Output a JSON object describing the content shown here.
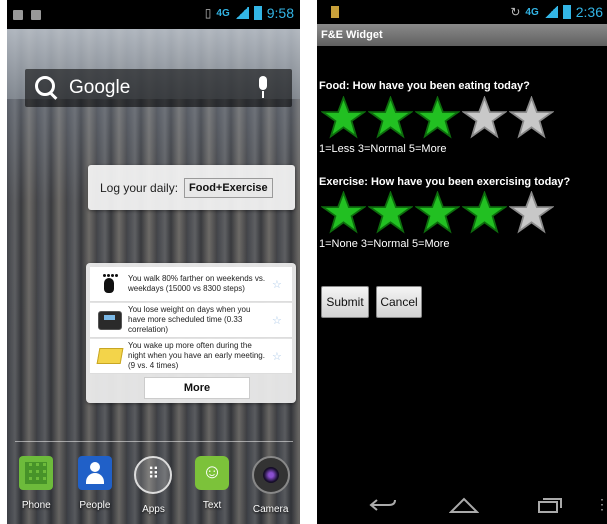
{
  "left": {
    "status": {
      "time": "9:58",
      "network": "4G"
    },
    "search": {
      "brand": "Google"
    },
    "log_widget": {
      "label": "Log your daily:",
      "button": "Food+Exercise"
    },
    "insights": [
      {
        "icon": "footprint-icon",
        "text": "You walk 80% farther on weekends vs. weekdays (15000 vs 8300 steps)"
      },
      {
        "icon": "scale-icon",
        "text": "You lose weight on days when you have more scheduled time (0.33 correlation)"
      },
      {
        "icon": "notepad-icon",
        "text": "You wake up more often during the night when you have an early meeting. (9 vs. 4 times)"
      }
    ],
    "more_label": "More",
    "dock": [
      {
        "label": "Phone",
        "icon": "phone-icon"
      },
      {
        "label": "People",
        "icon": "people-icon"
      },
      {
        "label": "Apps",
        "icon": "apps-icon"
      },
      {
        "label": "Text",
        "icon": "text-icon"
      },
      {
        "label": "Camera",
        "icon": "camera-icon"
      }
    ]
  },
  "right": {
    "status": {
      "time": "2:36",
      "network": "4G"
    },
    "title": "F&E Widget",
    "food": {
      "question": "Food: How have you been eating today?",
      "rating": 3,
      "max": 5,
      "scale": "1=Less 3=Normal 5=More"
    },
    "exercise": {
      "question": "Exercise: How have you been exercising today?",
      "rating": 4,
      "max": 5,
      "scale": "1=None 3=Normal 5=More"
    },
    "submit": "Submit",
    "cancel": "Cancel"
  },
  "colors": {
    "accent": "#33b5e5",
    "star_on": "#22c022",
    "star_off": "#c8c8c8"
  }
}
